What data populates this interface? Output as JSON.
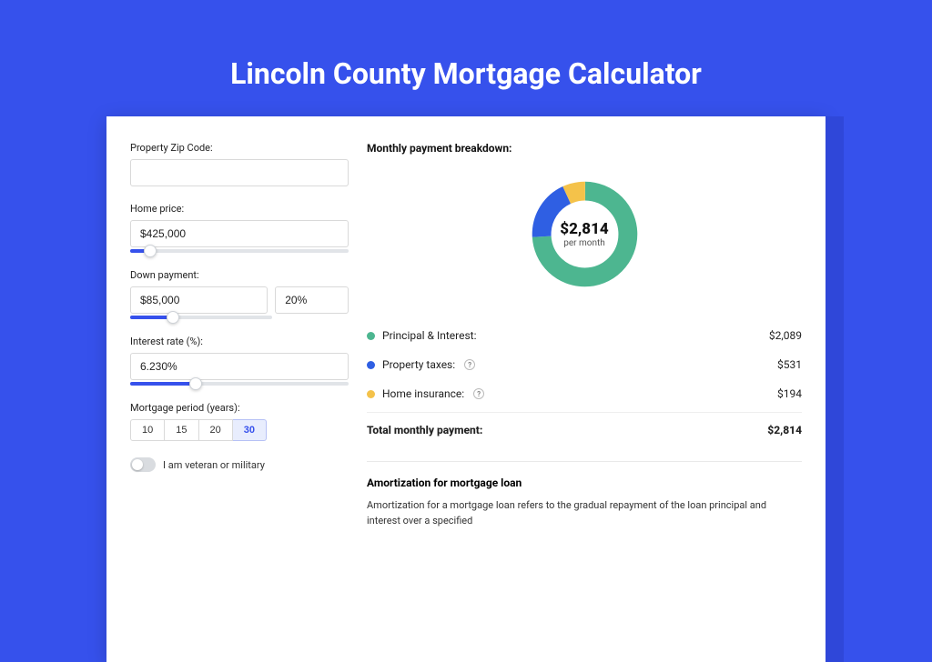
{
  "title": "Lincoln County Mortgage Calculator",
  "form": {
    "zip": {
      "label": "Property Zip Code:",
      "value": ""
    },
    "home_price": {
      "label": "Home price:",
      "value": "$425,000",
      "slider_pct": 9
    },
    "down": {
      "label": "Down payment:",
      "amount": "$85,000",
      "pct": "20%",
      "slider_pct": 20
    },
    "rate": {
      "label": "Interest rate (%):",
      "value": "6.230%",
      "slider_pct": 30
    },
    "period": {
      "label": "Mortgage period (years):",
      "options": [
        "10",
        "15",
        "20",
        "30"
      ],
      "active": "30"
    },
    "veteran": {
      "label": "I am veteran or military",
      "checked": false
    }
  },
  "breakdown": {
    "title": "Monthly payment breakdown:",
    "total_amount": "$2,814",
    "total_sub": "per month",
    "rows": [
      {
        "label": "Principal & Interest:",
        "value": "$2,089",
        "color": "g",
        "info": false
      },
      {
        "label": "Property taxes:",
        "value": "$531",
        "color": "b",
        "info": true
      },
      {
        "label": "Home insurance:",
        "value": "$194",
        "color": "y",
        "info": true
      }
    ],
    "total_row": {
      "label": "Total monthly payment:",
      "value": "$2,814"
    }
  },
  "chart_data": {
    "type": "pie",
    "title": "Monthly payment breakdown",
    "series": [
      {
        "name": "Principal & Interest",
        "value": 2089,
        "color": "#4db690"
      },
      {
        "name": "Property taxes",
        "value": 531,
        "color": "#2f5fe3"
      },
      {
        "name": "Home insurance",
        "value": 194,
        "color": "#f4c24a"
      }
    ],
    "center_label": "$2,814",
    "center_sub": "per month"
  },
  "amortization": {
    "title": "Amortization for mortgage loan",
    "text": "Amortization for a mortgage loan refers to the gradual repayment of the loan principal and interest over a specified"
  }
}
